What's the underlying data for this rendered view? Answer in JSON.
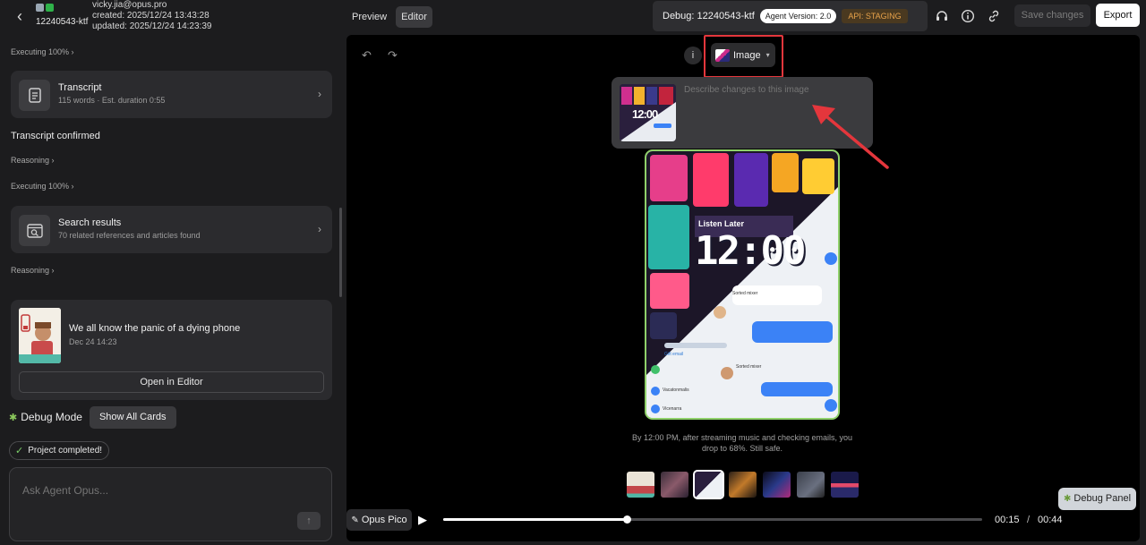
{
  "project": {
    "id_label": "12240543-ktf",
    "email": "vicky.jia@opus.pro",
    "created": "created: 2025/12/24 13:43:28",
    "updated": "updated: 2025/12/24 14:23:39"
  },
  "feed": {
    "executing_1": "Executing 100%",
    "transcript_card": {
      "title": "Transcript",
      "subtitle": "115 words · Est. duration 0:55"
    },
    "transcript_confirmed": "Transcript confirmed",
    "reasoning_1": "Reasoning",
    "executing_2": "Executing 100%",
    "search_card": {
      "title": "Search results",
      "subtitle": "70 related references and articles found"
    },
    "reasoning_2": "Reasoning",
    "video_card": {
      "title": "We all know the panic of a dying phone",
      "date": "Dec 24 14:23",
      "open_label": "Open in Editor"
    }
  },
  "debug": {
    "mode_label": "Debug Mode",
    "show_cards": "Show All Cards",
    "completed": "Project completed!"
  },
  "ask": {
    "placeholder": "Ask Agent Opus..."
  },
  "topbar": {
    "tab_preview": "Preview",
    "tab_editor": "Editor",
    "debug_label": "Debug: 12240543-ktf",
    "agent_version": "Agent Version: 2.0",
    "api": "API: STAGING",
    "save": "Save changes",
    "export": "Export",
    "icons": [
      "headset-icon",
      "info-icon",
      "link-icon"
    ]
  },
  "editor": {
    "image_dropdown": "Image",
    "edit_placeholder": "Describe changes to this image",
    "thumb_clock": "12:00",
    "caption": "By 12:00 PM, after streaming music and checking emails, you drop to 68%. Still safe.",
    "phone": {
      "listen_later": "Listen Later",
      "clock": "12:00",
      "labels": [
        "Sorted mixer",
        "Gift email",
        "Sorted mixer",
        "Vacatonmalis",
        "Vicenarra"
      ]
    },
    "player": {
      "opus_pico": "Opus Pico",
      "current": "00:15",
      "separator": "/",
      "total": "00:44",
      "progress": 0.34
    },
    "debug_panel": "Debug Panel"
  },
  "colors": {
    "accent_red": "#e4363c",
    "api_orange": "#e7a24a",
    "phone_border": "#8fd06a",
    "success_green": "#7ccf6a"
  }
}
